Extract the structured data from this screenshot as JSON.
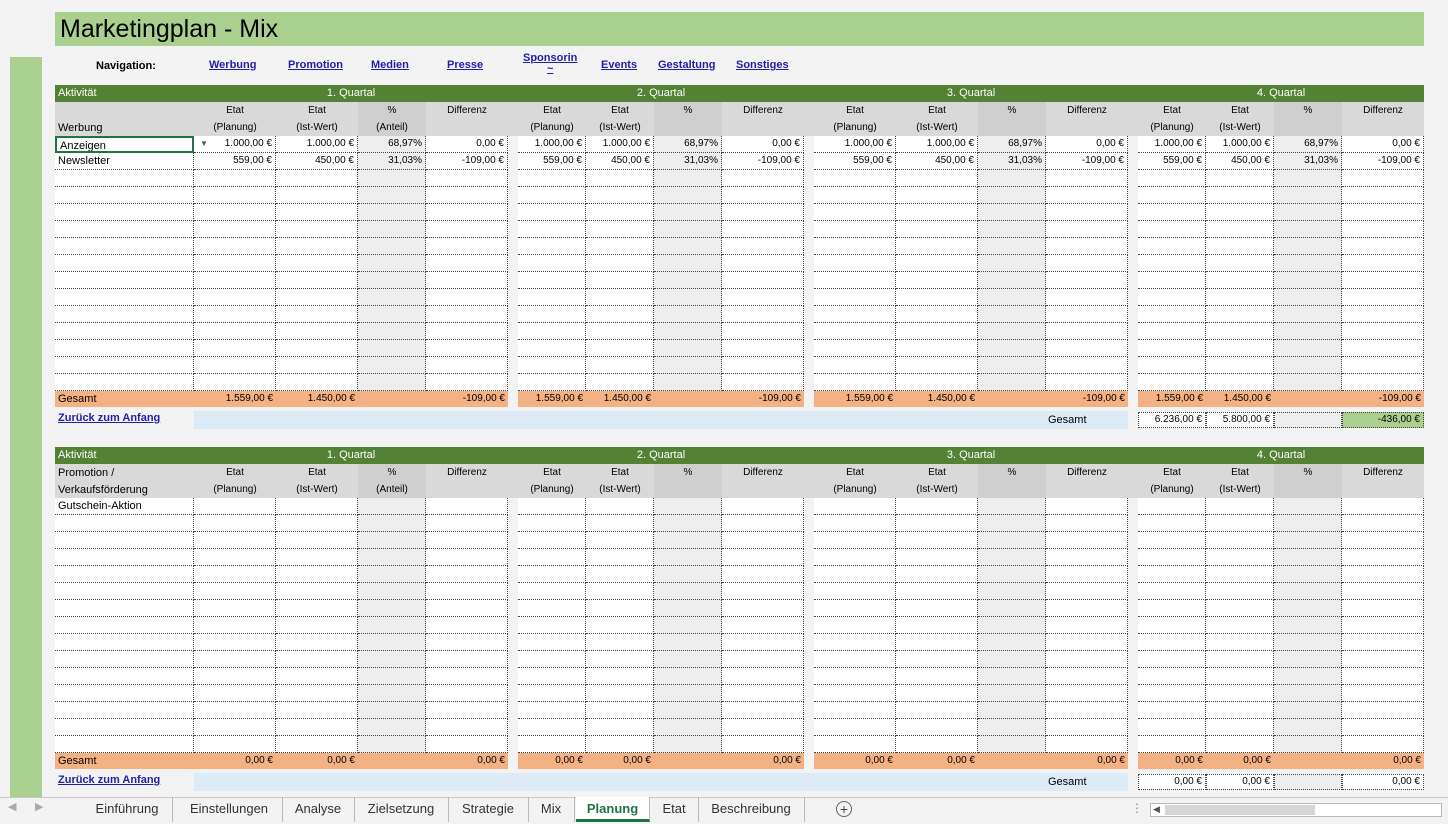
{
  "title": "Marketingplan - Mix",
  "navigation": {
    "label": "Navigation:",
    "links": [
      "Werbung",
      "Promotion",
      "Medien",
      "Presse",
      "Sponsorin\n~",
      "Events",
      "Gestaltung",
      "Sonstiges"
    ]
  },
  "colors": {
    "title_band": "#a9d08e",
    "header_green": "#548235",
    "total_orange": "#f4b183",
    "back_bar_blue": "#ddebf7",
    "accent": "#217346",
    "link": "#1f1fa8"
  },
  "block1": {
    "activity_header": "Aktivität",
    "quarters": [
      "1. Quartal",
      "2. Quartal",
      "3. Quartal",
      "4. Quartal"
    ],
    "category_label": "Werbung",
    "col_etat": "Etat",
    "col_planung": "(Planung)",
    "col_istwert": "(Ist-Wert)",
    "col_pct": "%",
    "col_anteil": "(Anteil)",
    "col_diff": "Differenz",
    "rows": [
      {
        "name": "Anzeigen",
        "q": [
          [
            "1.000,00 €",
            "1.000,00 €",
            "68,97%",
            "0,00 €"
          ],
          [
            "1.000,00 €",
            "1.000,00 €",
            "68,97%",
            "0,00 €"
          ],
          [
            "1.000,00 €",
            "1.000,00 €",
            "68,97%",
            "0,00 €"
          ],
          [
            "1.000,00 €",
            "1.000,00 €",
            "68,97%",
            "0,00 €"
          ]
        ]
      },
      {
        "name": "Newsletter",
        "q": [
          [
            "559,00 €",
            "450,00 €",
            "31,03%",
            "-109,00 €"
          ],
          [
            "559,00 €",
            "450,00 €",
            "31,03%",
            "-109,00 €"
          ],
          [
            "559,00 €",
            "450,00 €",
            "31,03%",
            "-109,00 €"
          ],
          [
            "559,00 €",
            "450,00 €",
            "31,03%",
            "-109,00 €"
          ]
        ]
      }
    ],
    "total_label": "Gesamt",
    "totals": [
      [
        "1.559,00 €",
        "1.450,00 €",
        "-109,00 €"
      ],
      [
        "1.559,00 €",
        "1.450,00 €",
        "-109,00 €"
      ],
      [
        "1.559,00 €",
        "1.450,00 €",
        "-109,00 €"
      ],
      [
        "1.559,00 €",
        "1.450,00 €",
        "-109,00 €"
      ]
    ],
    "back_link": "Zurück zum Anfang",
    "grand_label": "Gesamt",
    "grand": [
      "6.236,00 €",
      "5.800,00 €",
      "",
      "-436,00 €"
    ]
  },
  "block2": {
    "activity_header": "Aktivität",
    "quarters": [
      "1. Quartal",
      "2. Quartal",
      "3. Quartal",
      "4. Quartal"
    ],
    "category_label_1": "Promotion /",
    "category_label_2": "Verkaufsförderung",
    "col_etat": "Etat",
    "col_planung": "(Planung)",
    "col_istwert": "(Ist-Wert)",
    "col_pct": "%",
    "col_anteil": "(Anteil)",
    "col_diff": "Differenz",
    "rows": [
      {
        "name": "Gutschein-Aktion"
      }
    ],
    "total_label": "Gesamt",
    "totals": [
      [
        "0,00 €",
        "0,00 €",
        "0,00 €"
      ],
      [
        "0,00 €",
        "0,00 €",
        "0,00 €"
      ],
      [
        "0,00 €",
        "0,00 €",
        "0,00 €"
      ],
      [
        "0,00 €",
        "0,00 €",
        "0,00 €"
      ]
    ],
    "back_link": "Zurück zum Anfang",
    "grand_label": "Gesamt",
    "grand": [
      "0,00 €",
      "0,00 €",
      "",
      "0,00 €"
    ]
  },
  "tabs": [
    "Einführung",
    "Einstellungen",
    "Analyse",
    "Zielsetzung",
    "Strategie",
    "Mix",
    "Planung",
    "Etat",
    "Beschreibung"
  ],
  "active_tab": "Planung",
  "add_sheet_icon": "plus-circle-icon"
}
